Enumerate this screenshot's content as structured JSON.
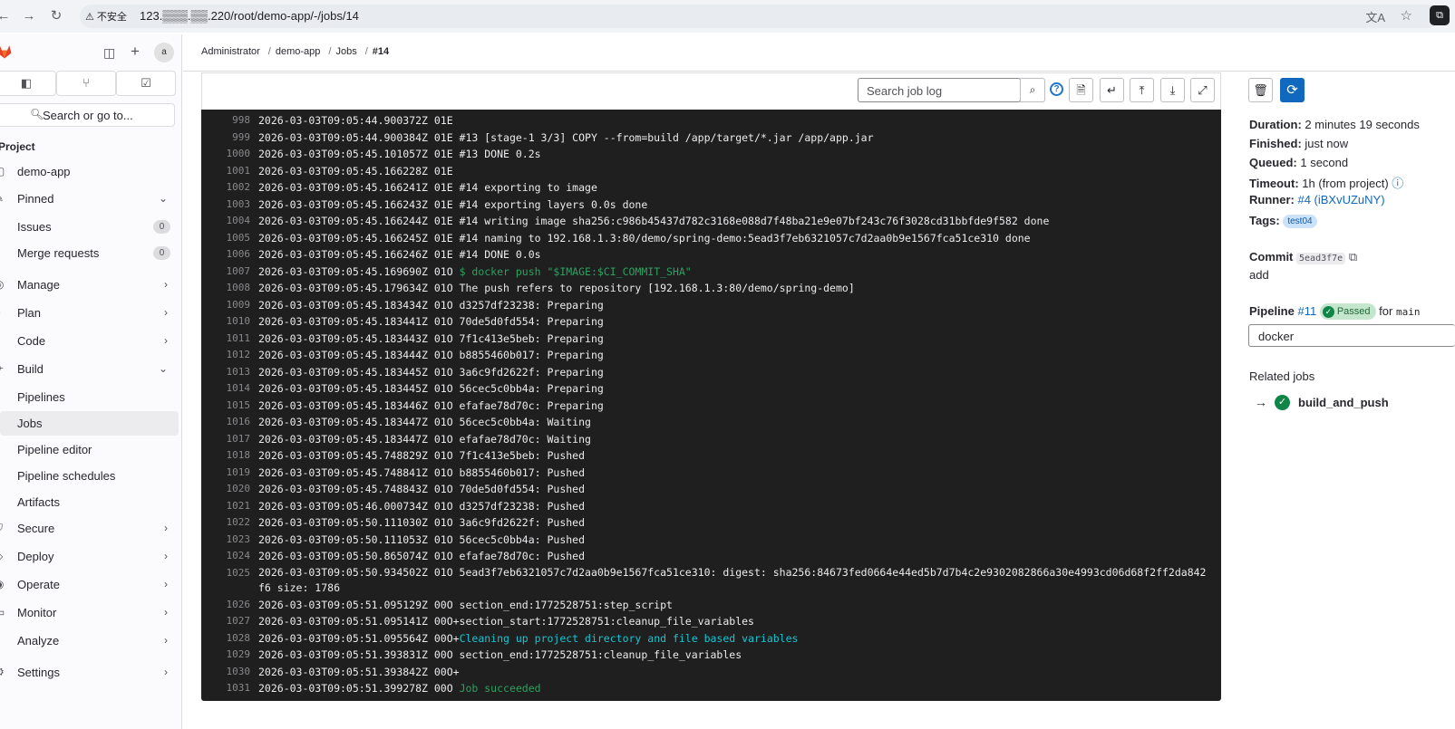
{
  "browser": {
    "insecure_label": "⚠ 不安全",
    "url": "123.▒▒▒.▒▒.220/root/demo-app/-/jobs/14"
  },
  "sidebar": {
    "avatar_text": "a",
    "search_label": "Search or go to...",
    "section_label": "Project",
    "project": "demo-app",
    "pinned": "Pinned",
    "issues": "Issues",
    "issues_count": "0",
    "merge_requests": "Merge requests",
    "merge_requests_count": "0",
    "manage": "Manage",
    "plan": "Plan",
    "code": "Code",
    "build": "Build",
    "pipelines": "Pipelines",
    "jobs": "Jobs",
    "pipeline_editor": "Pipeline editor",
    "pipeline_schedules": "Pipeline schedules",
    "artifacts": "Artifacts",
    "secure": "Secure",
    "deploy": "Deploy",
    "operate": "Operate",
    "monitor": "Monitor",
    "analyze": "Analyze",
    "settings": "Settings"
  },
  "breadcrumb": [
    "Administrator",
    "demo-app",
    "Jobs",
    "#14"
  ],
  "log_toolbar": {
    "search_placeholder": "Search job log"
  },
  "log": {
    "lines": [
      {
        "n": "998",
        "t": "2026-03-03T09:05:44.900372Z 01E "
      },
      {
        "n": "999",
        "t": "2026-03-03T09:05:44.900384Z 01E #13 [stage-1 3/3] COPY --from=build /app/target/*.jar /app/app.jar"
      },
      {
        "n": "1000",
        "t": "2026-03-03T09:05:45.101057Z 01E #13 DONE 0.2s"
      },
      {
        "n": "1001",
        "t": "2026-03-03T09:05:45.166228Z 01E "
      },
      {
        "n": "1002",
        "t": "2026-03-03T09:05:45.166241Z 01E #14 exporting to image"
      },
      {
        "n": "1003",
        "t": "2026-03-03T09:05:45.166243Z 01E #14 exporting layers 0.0s done"
      },
      {
        "n": "1004",
        "t": "2026-03-03T09:05:45.166244Z 01E #14 writing image sha256:c986b45437d782c3168e088d7f48ba21e9e07bf243c76f3028cd31bbfde9f582 done"
      },
      {
        "n": "1005",
        "t": "2026-03-03T09:05:45.166245Z 01E #14 naming to 192.168.1.3:80/demo/spring-demo:5ead3f7eb6321057c7d2aa0b9e1567fca51ce310 done"
      },
      {
        "n": "1006",
        "t": "2026-03-03T09:05:45.166246Z 01E #14 DONE 0.0s"
      },
      {
        "n": "1007",
        "t": "2026-03-03T09:05:45.169690Z 01O ",
        "g": "$ docker push \"$IMAGE:$CI_COMMIT_SHA\""
      },
      {
        "n": "1008",
        "t": "2026-03-03T09:05:45.179634Z 01O The push refers to repository [192.168.1.3:80/demo/spring-demo]"
      },
      {
        "n": "1009",
        "t": "2026-03-03T09:05:45.183434Z 01O d3257df23238: Preparing"
      },
      {
        "n": "1010",
        "t": "2026-03-03T09:05:45.183441Z 01O 70de5d0fd554: Preparing"
      },
      {
        "n": "1011",
        "t": "2026-03-03T09:05:45.183443Z 01O 7f1c413e5beb: Preparing"
      },
      {
        "n": "1012",
        "t": "2026-03-03T09:05:45.183444Z 01O b8855460b017: Preparing"
      },
      {
        "n": "1013",
        "t": "2026-03-03T09:05:45.183445Z 01O 3a6c9fd2622f: Preparing"
      },
      {
        "n": "1014",
        "t": "2026-03-03T09:05:45.183445Z 01O 56cec5c0bb4a: Preparing"
      },
      {
        "n": "1015",
        "t": "2026-03-03T09:05:45.183446Z 01O efafae78d70c: Preparing"
      },
      {
        "n": "1016",
        "t": "2026-03-03T09:05:45.183447Z 01O 56cec5c0bb4a: Waiting"
      },
      {
        "n": "1017",
        "t": "2026-03-03T09:05:45.183447Z 01O efafae78d70c: Waiting"
      },
      {
        "n": "1018",
        "t": "2026-03-03T09:05:45.748829Z 01O 7f1c413e5beb: Pushed"
      },
      {
        "n": "1019",
        "t": "2026-03-03T09:05:45.748841Z 01O b8855460b017: Pushed"
      },
      {
        "n": "1020",
        "t": "2026-03-03T09:05:45.748843Z 01O 70de5d0fd554: Pushed"
      },
      {
        "n": "1021",
        "t": "2026-03-03T09:05:46.000734Z 01O d3257df23238: Pushed"
      },
      {
        "n": "1022",
        "t": "2026-03-03T09:05:50.111030Z 01O 3a6c9fd2622f: Pushed"
      },
      {
        "n": "1023",
        "t": "2026-03-03T09:05:50.111053Z 01O 56cec5c0bb4a: Pushed"
      },
      {
        "n": "1024",
        "t": "2026-03-03T09:05:50.865074Z 01O efafae78d70c: Pushed"
      },
      {
        "n": "1025",
        "t": "2026-03-03T09:05:50.934502Z 01O 5ead3f7eb6321057c7d2aa0b9e1567fca51ce310: digest: sha256:84673fed0664e44ed5b7d7b4c2e9302082866a30e4993cd06d68f2ff2da842f6 size: 1786",
        "wrap": true
      },
      {
        "n": "1026",
        "t": "2026-03-03T09:05:51.095129Z 00O section_end:1772528751:step_script"
      },
      {
        "n": "1027",
        "t": "2026-03-03T09:05:51.095141Z 00O+section_start:1772528751:cleanup_file_variables"
      },
      {
        "n": "1028",
        "t": "2026-03-03T09:05:51.095564Z 00O+",
        "c": "Cleaning up project directory and file based variables"
      },
      {
        "n": "1029",
        "t": "2026-03-03T09:05:51.393831Z 00O section_end:1772528751:cleanup_file_variables"
      },
      {
        "n": "1030",
        "t": "2026-03-03T09:05:51.393842Z 00O+"
      },
      {
        "n": "1031",
        "t": "2026-03-03T09:05:51.399278Z 00O ",
        "g": "Job succeeded"
      }
    ]
  },
  "job": {
    "duration_label": "Duration:",
    "duration": "2 minutes 19 seconds",
    "finished_label": "Finished:",
    "finished": "just now",
    "queued_label": "Queued:",
    "queued": "1 second",
    "timeout_label": "Timeout:",
    "timeout": "1h (from project)",
    "runner_label": "Runner:",
    "runner": "#4 (iBXvUZuNY)",
    "tags_label": "Tags:",
    "tag": "test04",
    "commit_label": "Commit",
    "commit_sha": "5ead3f7e",
    "commit_message": "add",
    "pipeline_label": "Pipeline",
    "pipeline_id": "#11",
    "pipeline_status": "Passed",
    "pipeline_for": "for",
    "pipeline_ref": "main",
    "stage": "docker",
    "related_jobs_label": "Related jobs",
    "related_job": "build_and_push"
  },
  "colors": {
    "log_bg": "#1f1f1f",
    "accent": "#1068bf",
    "success": "#108548",
    "log_green": "#2da160",
    "log_cyan": "#17c5d3"
  }
}
